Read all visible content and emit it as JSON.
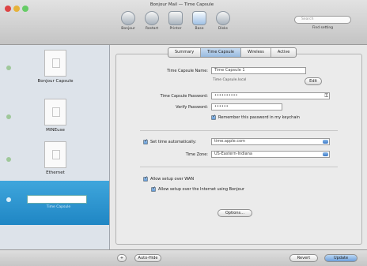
{
  "window": {
    "title": "Bonjour Mail — Time Capsule"
  },
  "toolbar": {
    "items": [
      {
        "label": "Bonjour",
        "icon": "reload-icon"
      },
      {
        "label": "Restart",
        "icon": "airport-icon"
      },
      {
        "label": "Printer",
        "icon": "printer-icon"
      },
      {
        "label": "Base",
        "icon": "base-station-icon"
      },
      {
        "label": "Disks",
        "icon": "disk-icon"
      }
    ],
    "search_placeholder": "Search",
    "search_caption": "Find setting"
  },
  "sidebar": {
    "items": [
      {
        "label": "Bonjour Capsule",
        "icon": "device-icon"
      },
      {
        "label": "MINEuse",
        "icon": "device-icon"
      },
      {
        "label": "Ethernet",
        "icon": "device-icon"
      }
    ],
    "selected_field_value": "",
    "selected_sub": "Time Capsule"
  },
  "tabs": [
    "Summary",
    "Time Capsule",
    "Wireless",
    "Active"
  ],
  "form": {
    "name_label": "Time Capsule Name:",
    "name_value": "Time Capsule 1",
    "name_sub": "Time Capsule.local",
    "edit_button": "Edit",
    "password_label": "Time Capsule Password:",
    "password_value": "••••••••••",
    "verify_label": "Verify Password:",
    "verify_value": "••••••",
    "remember_label": "Remember this password in my keychain",
    "set_time_label": "Set time automatically:",
    "time_server": "time.apple.com",
    "time_zone_label": "Time Zone:",
    "time_zone_value": "US-Eastern-Indiana",
    "allow_wan_label": "Allow setup over WAN",
    "advertise_label": "Allow setup over the Internet using Bonjour",
    "options_button": "Options…"
  },
  "footer": {
    "add_label": "Auto-Hide",
    "revert_button": "Revert",
    "update_button": "Update"
  },
  "colors": {
    "selection": "#2a93cf",
    "sidebar_bg": "#dde3ea",
    "panel_bg": "#ebebeb"
  }
}
